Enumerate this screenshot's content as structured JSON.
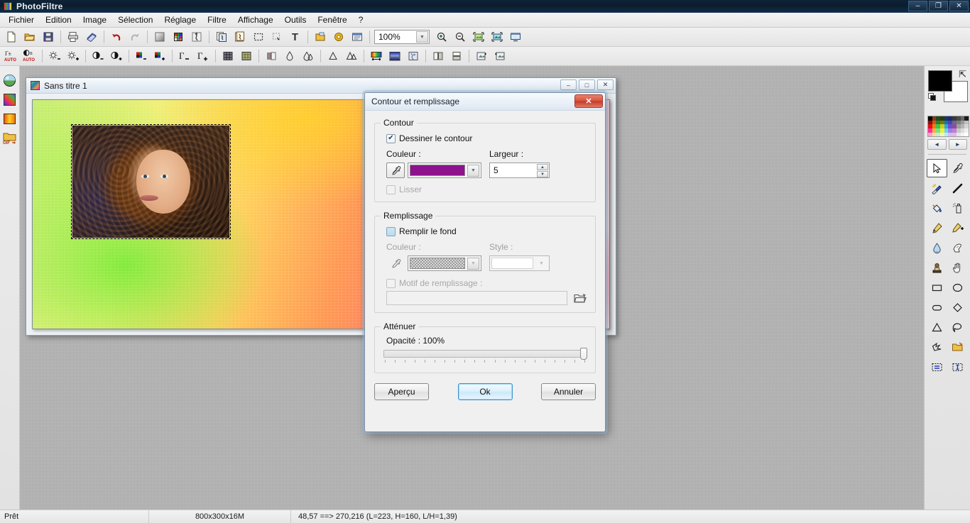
{
  "window": {
    "app_title": "PhotoFiltre",
    "app_icon": "photofiltre-logo-icon",
    "minimize_label": "–",
    "restore_label": "❐",
    "close_label": "✕"
  },
  "menubar": {
    "items": [
      {
        "label": "Fichier",
        "name": "menu-fichier"
      },
      {
        "label": "Edition",
        "name": "menu-edition"
      },
      {
        "label": "Image",
        "name": "menu-image"
      },
      {
        "label": "Sélection",
        "name": "menu-selection"
      },
      {
        "label": "Réglage",
        "name": "menu-reglage"
      },
      {
        "label": "Filtre",
        "name": "menu-filtre"
      },
      {
        "label": "Affichage",
        "name": "menu-affichage"
      },
      {
        "label": "Outils",
        "name": "menu-outils"
      },
      {
        "label": "Fenêtre",
        "name": "menu-fenetre"
      },
      {
        "label": "?",
        "name": "menu-aide"
      }
    ]
  },
  "toolbar_main": {
    "zoom_value": "100%",
    "icons": [
      "new-document-icon",
      "open-folder-icon",
      "save-floppy-icon",
      "print-icon",
      "print-preview-icon",
      "undo-arrow-icon",
      "redo-arrow-icon",
      "grayscale-square-icon",
      "color-palette-icon",
      "artistic-filter-icon",
      "copy-image-icon",
      "paste-image-icon",
      "selection-marquee-icon",
      "deselect-icon",
      "text-tool-icon",
      "layers-icon",
      "automation-gear-icon",
      "batch-window-icon",
      "zoom-in-icon",
      "zoom-out-icon",
      "fit-image-icon",
      "actual-size-icon",
      "fullscreen-icon"
    ]
  },
  "toolbar_secondary": {
    "icons": [
      "auto-levels-icon",
      "auto-contrast-icon",
      "brightness-down-icon",
      "brightness-up-icon",
      "contrast-down-icon",
      "contrast-up-icon",
      "saturation-down-icon",
      "saturation-up-icon",
      "gamma-down-icon",
      "gamma-up-icon",
      "grid-icon",
      "mosaic-icon",
      "dither-icon",
      "blur-drop-icon",
      "blur-more-icon",
      "sharpen-icon",
      "sharpen-more-icon",
      "gradient-linear-icon",
      "gradient-box-icon",
      "texture-icon",
      "flip-horizontal-icon",
      "flip-vertical-icon",
      "rotate-left-icon",
      "rotate-right-icon"
    ]
  },
  "leftbar": {
    "items": [
      {
        "name": "gradient-sphere-icon"
      },
      {
        "name": "rainbow-pattern-icon"
      },
      {
        "name": "orange-gradient-icon"
      },
      {
        "name": "gif-export-icon"
      }
    ]
  },
  "document": {
    "title": "Sans titre 1",
    "icon": "image-document-icon",
    "minimize_label": "–",
    "restore_label": "□",
    "close_label": "✕"
  },
  "right_panel": {
    "foreground_color": "#000000",
    "background_color": "#ffffff",
    "swap_icon": "swap-colors-icon",
    "reset_icon": "default-colors-icon",
    "prev_label": "◄",
    "next_label": "►",
    "palette": [
      "#000000",
      "#8a3a18",
      "#1d4e1d",
      "#2e3b0d",
      "#123a6b",
      "#1f2a6e",
      "#3a3a3a",
      "#4a4a4a",
      "#6a6a6a",
      "#1a1a1a",
      "#8a0f0f",
      "#d4531a",
      "#2f7a2f",
      "#6d7a13",
      "#1f6fb8",
      "#4547a8",
      "#6a6a8a",
      "#7e7e7e",
      "#9a9a9a",
      "#c0c0c0",
      "#e01010",
      "#ec7a1c",
      "#46c046",
      "#c8d018",
      "#2fa8e0",
      "#6a4fd0",
      "#8a4f9a",
      "#9f9f9f",
      "#b4b4b4",
      "#d4d4d4",
      "#ff2fa0",
      "#ffb040",
      "#7ee07e",
      "#e8f04a",
      "#6ed0f0",
      "#9a7fe8",
      "#c07fd0",
      "#c8c8c8",
      "#dcdcdc",
      "#eeeeee",
      "#ff9fd0",
      "#ffd9a0",
      "#c4f0c4",
      "#f2f8b0",
      "#bce8f8",
      "#cfc0f4",
      "#e0b8e8",
      "#e8e8e8",
      "#f4f4f4",
      "#ffffff"
    ],
    "tools": [
      {
        "name": "tool-select-arrow-icon",
        "selected": true
      },
      {
        "name": "tool-eyedropper-icon",
        "selected": false
      },
      {
        "name": "tool-magic-wand-icon",
        "selected": false
      },
      {
        "name": "tool-line-icon",
        "selected": false
      },
      {
        "name": "tool-paint-bucket-icon",
        "selected": false
      },
      {
        "name": "tool-spray-can-icon",
        "selected": false
      },
      {
        "name": "tool-paintbrush-icon",
        "selected": false
      },
      {
        "name": "tool-paintbrush-advanced-icon",
        "selected": false
      },
      {
        "name": "tool-water-drop-icon",
        "selected": false
      },
      {
        "name": "tool-smudge-finger-icon",
        "selected": false
      },
      {
        "name": "tool-clone-stamp-icon",
        "selected": false
      },
      {
        "name": "tool-hand-pan-icon",
        "selected": false
      },
      {
        "name": "shape-rectangle-icon",
        "selected": false
      },
      {
        "name": "shape-ellipse-icon",
        "selected": false
      },
      {
        "name": "shape-rounded-rectangle-icon",
        "selected": false
      },
      {
        "name": "shape-diamond-icon",
        "selected": false
      },
      {
        "name": "shape-triangle-icon",
        "selected": false
      },
      {
        "name": "shape-lasso-icon",
        "selected": false
      },
      {
        "name": "shape-polygon-icon",
        "selected": false
      },
      {
        "name": "load-selection-icon",
        "selected": false
      },
      {
        "name": "selection-horizontal-icon",
        "selected": false
      },
      {
        "name": "selection-vertical-icon",
        "selected": false
      }
    ]
  },
  "statusbar": {
    "status": "Prêt",
    "image_info": "800x300x16M",
    "coords": "48,57 ==> 270,216 (L=223, H=160, L/H=1,39)"
  },
  "dialog": {
    "title": "Contour et remplissage",
    "close_label": "✕",
    "contour": {
      "legend": "Contour",
      "draw_checkbox_label": "Dessiner le contour",
      "draw_checked": true,
      "color_label": "Couleur :",
      "color_value": "#8e118e",
      "eyedropper_icon": "eyedropper-icon",
      "dropdown_icon": "chevron-down-icon",
      "width_label": "Largeur :",
      "width_value": "5",
      "spin_up_icon": "spin-up-icon",
      "spin_down_icon": "spin-down-icon",
      "smooth_checkbox_label": "Lisser",
      "smooth_checked": false,
      "smooth_disabled": true
    },
    "remplissage": {
      "legend": "Remplissage",
      "fill_checkbox_label": "Remplir le fond",
      "fill_checked": false,
      "color_label": "Couleur :",
      "color_value": "checkered-transparent",
      "style_label": "Style :",
      "style_value": "",
      "pattern_checkbox_label": "Motif de remplissage :",
      "pattern_checked": false,
      "pattern_path": "",
      "browse_icon": "open-folder-icon"
    },
    "attenuer": {
      "legend": "Atténuer",
      "opacity_label": "Opacité : 100%",
      "opacity_value": 100,
      "opacity_min": 0,
      "opacity_max": 100
    },
    "buttons": {
      "preview": "Aperçu",
      "ok": "Ok",
      "cancel": "Annuler"
    }
  }
}
